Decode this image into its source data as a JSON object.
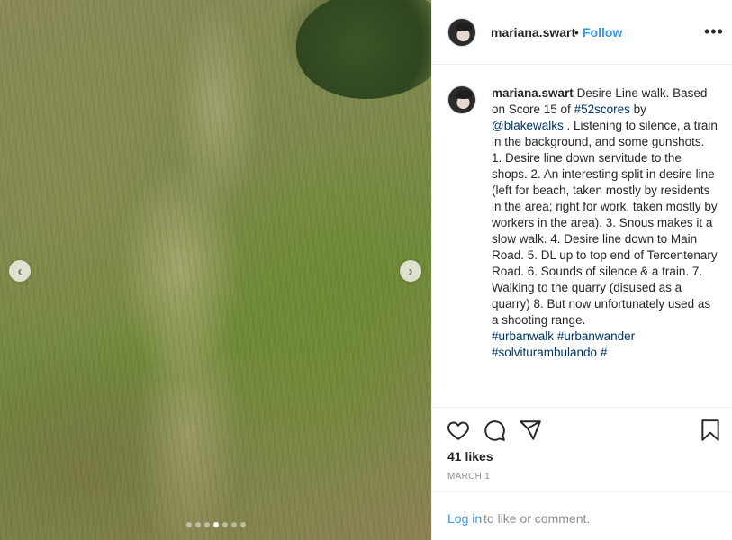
{
  "post": {
    "username": "mariana.swart",
    "separator": "•",
    "follow_label": "Follow",
    "more_icon": "ellipsis-icon"
  },
  "carousel": {
    "prev_icon": "‹",
    "next_icon": "›",
    "total_slides": 7,
    "active_index": 3
  },
  "caption": {
    "username": "mariana.swart",
    "intro": "Desire Line walk. Based on Score 15 of ",
    "hashtag_52scores": "#52scores",
    "by": " by ",
    "mention": "@blakewalks",
    "intro_tail": " . Listening to silence, a train in the background, and some gunshots.",
    "body": "1. Desire line down servitude to the shops. 2. An interesting split in desire line (left for beach, taken mostly by residents in the area; right for work, taken mostly by workers in the area). 3. Snous makes it a slow walk. 4. Desire line down to Main Road. 5. DL up to top end of Tercentenary Road. 6. Sounds of silence & a train. 7. Walking to the quarry (disused as a quarry) 8. But now unfortunately used as a shooting range.",
    "tags": [
      "#urbanwalk",
      "#urbanwander",
      "#solviturambulando",
      "#"
    ]
  },
  "actions": {
    "like_icon": "heart-icon",
    "comment_icon": "comment-icon",
    "share_icon": "send-icon",
    "save_icon": "bookmark-icon"
  },
  "likes_text": "41 likes",
  "date_text": "MARCH 1",
  "login": {
    "link": "Log in",
    "rest": " to like or comment."
  },
  "colors": {
    "link_blue": "#3897f0",
    "hashtag_blue": "#003569",
    "text": "#262626",
    "muted": "#8e8e8e",
    "border": "#efefef"
  }
}
